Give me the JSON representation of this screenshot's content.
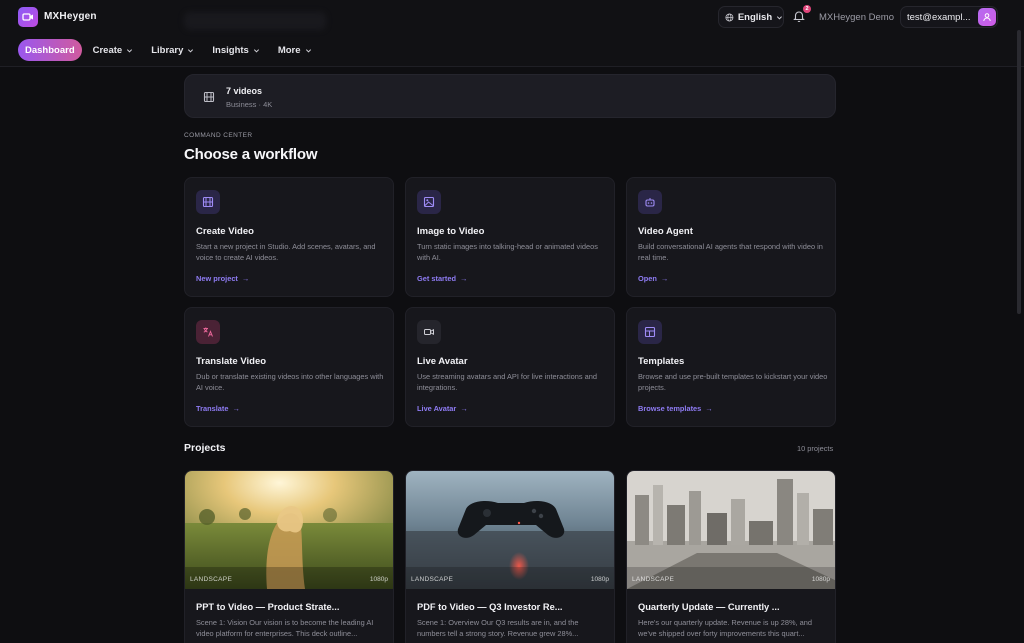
{
  "app": {
    "name": "MXHeygen"
  },
  "header": {
    "language": "English",
    "notification_count": "2",
    "account_name": "MXHeygen Demo",
    "email": "test@exampl..."
  },
  "nav": {
    "dashboard": "Dashboard",
    "create": "Create",
    "library": "Library",
    "insights": "Insights",
    "more": "More"
  },
  "summary": {
    "title": "7 videos",
    "subtitle": "Business · 4K"
  },
  "workflow": {
    "eyebrow": "COMMAND CENTER",
    "heading": "Choose a workflow",
    "cards": [
      {
        "title": "Create Video",
        "description": "Start a new project in Studio. Add scenes, avatars, and voice to create AI videos.",
        "link": "New project",
        "icon": "film-icon"
      },
      {
        "title": "Image to Video",
        "description": "Turn static images into talking-head or animated videos with AI.",
        "link": "Get started",
        "icon": "image-icon"
      },
      {
        "title": "Video Agent",
        "description": "Build conversational AI agents that respond with video in real time.",
        "link": "Open",
        "icon": "bot-icon"
      },
      {
        "title": "Translate Video",
        "description": "Dub or translate existing videos into other languages with AI voice.",
        "link": "Translate",
        "icon": "translate-icon"
      },
      {
        "title": "Live Avatar",
        "description": "Use streaming avatars and API for live interactions and integrations.",
        "link": "Live Avatar",
        "icon": "video-camera-icon"
      },
      {
        "title": "Templates",
        "description": "Browse and use pre-built templates to kickstart your video projects.",
        "link": "Browse templates",
        "icon": "layout-icon"
      }
    ]
  },
  "projects": {
    "heading": "Projects",
    "count": "10 projects",
    "items": [
      {
        "tag": "LANDSCAPE",
        "resolution": "1080p",
        "title": "PPT to Video — Product Strate...",
        "description": "Scene 1: Vision Our vision is to become the leading AI video platform for enterprises. This deck outline..."
      },
      {
        "tag": "LANDSCAPE",
        "resolution": "1080p",
        "title": "PDF to Video — Q3 Investor Re...",
        "description": "Scene 1: Overview Our Q3 results are in, and the numbers tell a strong story. Revenue grew 28%..."
      },
      {
        "tag": "LANDSCAPE",
        "resolution": "1080p",
        "title": "Quarterly Update — Currently ...",
        "description": "Here's our quarterly update. Revenue is up 28%, and we've shipped over forty improvements this quart..."
      }
    ]
  },
  "colors": {
    "accent": "#8f7cf4",
    "active_nav_start": "#9a58ef",
    "active_nav_end": "#d05a9e",
    "background": "#0e0e11",
    "card": "#17171c"
  }
}
